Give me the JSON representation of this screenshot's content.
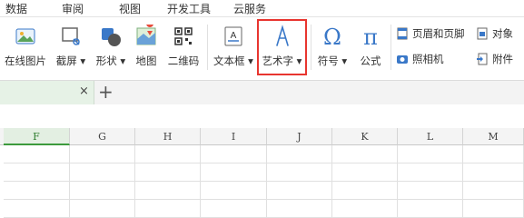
{
  "menu": [
    "数据",
    "审阅",
    "视图",
    "开发工具",
    "云服务"
  ],
  "toolbar": {
    "online_image": "在线图片",
    "screenshot": "截屏",
    "shapes": "形状",
    "map": "地图",
    "qrcode": "二维码",
    "textbox": "文本框",
    "wordart": "艺术字",
    "symbol": "符号",
    "formula": "公式",
    "header_footer": "页眉和页脚",
    "camera": "照相机",
    "object": "对象",
    "attachment": "附件"
  },
  "tabs": {
    "close": "×",
    "add": "+"
  },
  "columns": [
    "F",
    "G",
    "H",
    "I",
    "J",
    "K",
    "L",
    "M"
  ],
  "colors": {
    "highlight": "#e8352f",
    "accent": "#2f7d2f",
    "icon_blue": "#3a78c8"
  }
}
